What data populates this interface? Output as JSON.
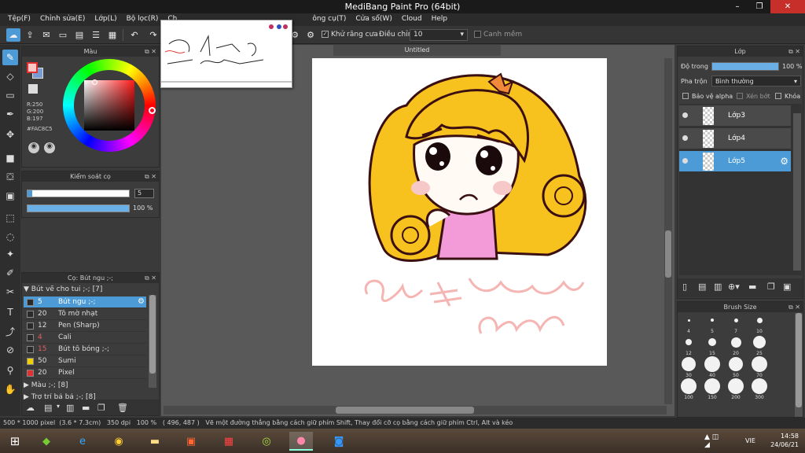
{
  "window": {
    "title": "MediBang Paint Pro (64bit)",
    "minimize": "–",
    "restore": "❐",
    "close": "✕"
  },
  "menu": [
    "Tệp(F)",
    "Chỉnh sửa(E)",
    "Lớp(L)",
    "Bộ lọc(R)",
    "Ch",
    "ông cụ(T)",
    "Cửa sổ(W)",
    "Cloud",
    "Help"
  ],
  "toolbar": {
    "antialias_label": "Khử răng cưa",
    "correction_label": "Điều chỉnh",
    "correction_value": "10",
    "snap_label": "Canh mềm"
  },
  "color_panel": {
    "title": "Màu",
    "r": "R:250",
    "g": "G:200",
    "b": "B:197",
    "hex": "#FAC8C5",
    "fg_color": "#FAC8C5"
  },
  "brush_control": {
    "title": "Kiểm soát cọ",
    "size": "5",
    "opacity": "100 %",
    "opacity_fraction": 1.0
  },
  "brush_panel": {
    "title": "Cọ: Bút ngu ;-;",
    "group_open": "Bút vẽ cho tui ;-; [7]",
    "items": [
      {
        "num": "5",
        "name": "Bút ngu ;-;",
        "swatch": "#2a2a2a",
        "num_color": "#e06060"
      },
      {
        "num": "20",
        "name": "Tô mờ nhạt",
        "swatch": "#2a2a2a",
        "num_color": "#dddddd"
      },
      {
        "num": "12",
        "name": "Pen (Sharp)",
        "swatch": "#2a2a2a",
        "num_color": "#dddddd"
      },
      {
        "num": "4",
        "name": "Cali",
        "swatch": "#2a2a2a",
        "num_color": "#e06060"
      },
      {
        "num": "15",
        "name": "Bút tô bóng ;-;",
        "swatch": "#2a2a2a",
        "num_color": "#e06060"
      },
      {
        "num": "50",
        "name": "Sumi",
        "swatch": "#f0d000",
        "num_color": "#dddddd"
      },
      {
        "num": "20",
        "name": "Pixel",
        "swatch": "#e03030",
        "num_color": "#dddddd"
      }
    ],
    "group_closed_1": "Màu ;-; [8]",
    "group_closed_2": "Trợ trí bả bả ;-; [8]"
  },
  "canvas": {
    "tab": "Untitled"
  },
  "layers": {
    "title": "Lớp",
    "opacity_label": "Độ trong",
    "opacity_value": "100 %",
    "blend_label": "Pha trộn",
    "blend_value": "Bình thường",
    "protect_alpha": "Bảo vệ alpha",
    "clip": "Xén bớt",
    "lock": "Khóa",
    "items": [
      {
        "name": "Lớp3",
        "selected": false
      },
      {
        "name": "Lớp4",
        "selected": false
      },
      {
        "name": "Lớp5",
        "selected": true
      }
    ]
  },
  "brush_size": {
    "title": "Brush Size",
    "sizes": [
      "4",
      "5",
      "7",
      "10",
      "12",
      "15",
      "20",
      "25",
      "30",
      "40",
      "50",
      "70",
      "100",
      "150",
      "200",
      "300"
    ]
  },
  "status": {
    "size": "500 * 1000 pixel",
    "cm": "(3.6 * 7.3cm)",
    "dpi": "350 dpi",
    "zoom": "100 %",
    "coords": "( 496, 487 )",
    "hint": "Vẽ một đường thẳng bằng cách giữ phím Shift, Thay đổi cỡ cọ bằng cách giữ phím Ctrl, Alt và kéo"
  },
  "taskbar": {
    "lang": "VIE",
    "time": "14:58",
    "date": "24/06/21"
  }
}
